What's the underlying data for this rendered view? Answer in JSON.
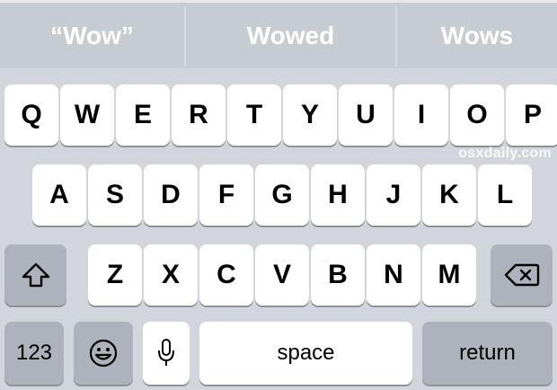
{
  "suggestions": [
    "“Wow”",
    "Wowed",
    "Wows"
  ],
  "rows": {
    "row1": [
      "Q",
      "W",
      "E",
      "R",
      "T",
      "Y",
      "U",
      "I",
      "O",
      "P"
    ],
    "row2": [
      "A",
      "S",
      "D",
      "F",
      "G",
      "H",
      "J",
      "K",
      "L"
    ],
    "row3": [
      "Z",
      "X",
      "C",
      "V",
      "B",
      "N",
      "M"
    ]
  },
  "bottom": {
    "numbers_label": "123",
    "space_label": "space",
    "return_label": "return"
  },
  "icons": {
    "shift": "shift-icon",
    "delete": "delete-icon",
    "emoji": "emoji-icon",
    "mic": "microphone-icon"
  },
  "watermark": "osxdaily.com",
  "colors": {
    "keyboard_bg": "#d2d5db",
    "key_bg": "#ffffff",
    "func_key_bg": "#adb2bc",
    "suggestion_text": "#ffffff"
  }
}
